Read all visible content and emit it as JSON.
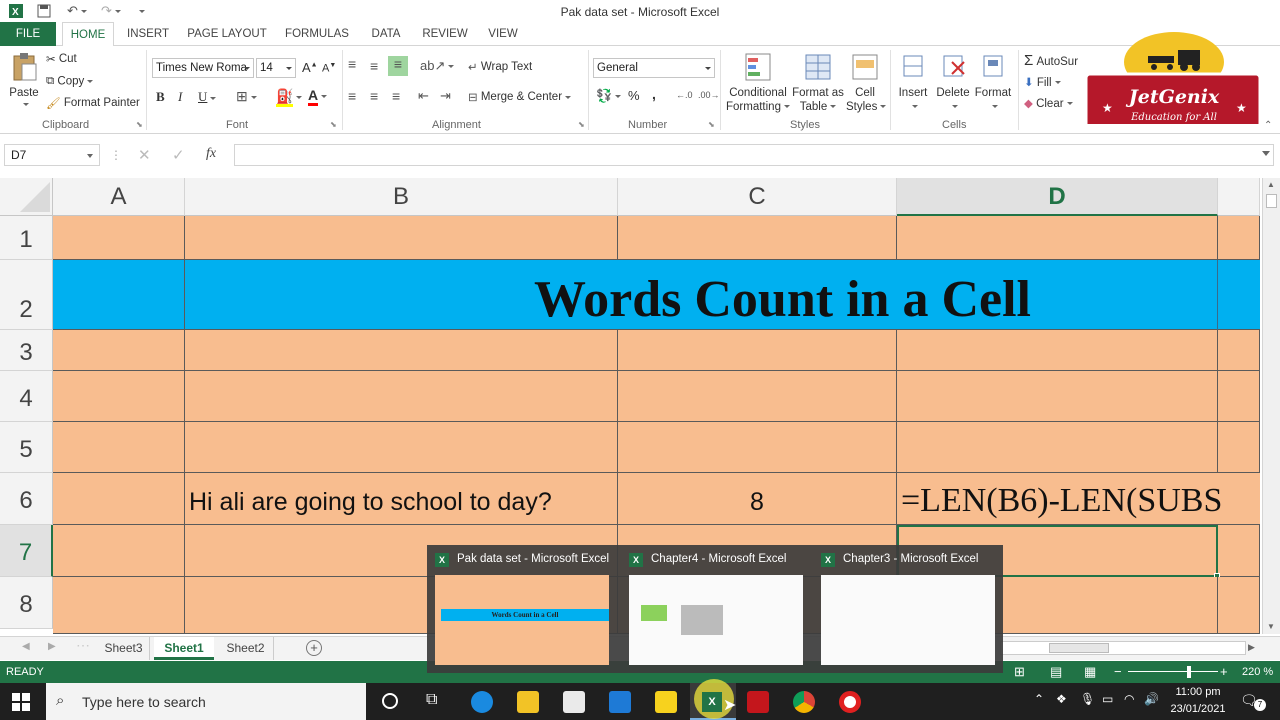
{
  "window": {
    "title": "Pak data set - Microsoft Excel"
  },
  "tabs": [
    "FILE",
    "HOME",
    "INSERT",
    "PAGE LAYOUT",
    "FORMULAS",
    "DATA",
    "REVIEW",
    "VIEW"
  ],
  "ribbon": {
    "clipboard": {
      "paste": "Paste",
      "cut": "Cut",
      "copy": "Copy",
      "format_painter": "Format Painter",
      "label": "Clipboard"
    },
    "font": {
      "name": "Times New Roma",
      "size": "14",
      "bold": "B",
      "italic": "I",
      "underline": "U",
      "grow": "A",
      "shrink": "A",
      "label": "Font"
    },
    "alignment": {
      "wrap": "Wrap Text",
      "merge": "Merge & Center",
      "label": "Alignment"
    },
    "number": {
      "format": "General",
      "percent": "%",
      "comma": ",",
      "label": "Number"
    },
    "styles": {
      "conditional": "Conditional",
      "conditional2": "Formatting",
      "format_table": "Format as",
      "format_table2": "Table",
      "cell_styles": "Cell",
      "cell_styles2": "Styles",
      "label": "Styles"
    },
    "cells": {
      "insert": "Insert",
      "delete": "Delete",
      "format": "Format",
      "label": "Cells"
    },
    "editing": {
      "autosum": "AutoSur",
      "fill": "Fill",
      "clear": "Clear"
    }
  },
  "logo": {
    "name": "JetGenix",
    "tagline": "Education for All"
  },
  "formula_bar": {
    "name_box": "D7",
    "fx": "fx",
    "value": ""
  },
  "columns": [
    "A",
    "B",
    "C",
    "D"
  ],
  "rows": [
    "1",
    "2",
    "3",
    "4",
    "5",
    "6",
    "7",
    "8"
  ],
  "cells": {
    "title": "Words Count in a Cell",
    "B6": "Hi ali are going to school to day?",
    "C6": "8",
    "D6": "=LEN(B6)-LEN(SUBS"
  },
  "sheets": [
    "Sheet3",
    "Sheet1",
    "Sheet2"
  ],
  "active_sheet": "Sheet1",
  "status": {
    "ready": "READY",
    "zoom": "220 %"
  },
  "taskbar": {
    "search_placeholder": "Type here to search",
    "time": "11:00 pm",
    "date": "23/01/2021",
    "notifications": "7"
  },
  "thumbnails": [
    {
      "title": "Pak data set - Microsoft Excel",
      "preview_title": "Words Count in a Cell"
    },
    {
      "title": "Chapter4 - Microsoft Excel"
    },
    {
      "title": "Chapter3 - Microsoft Excel"
    }
  ],
  "colors": {
    "excel_green": "#217346",
    "cell_fill": "#f8bd8f",
    "title_fill": "#00b0f0"
  }
}
